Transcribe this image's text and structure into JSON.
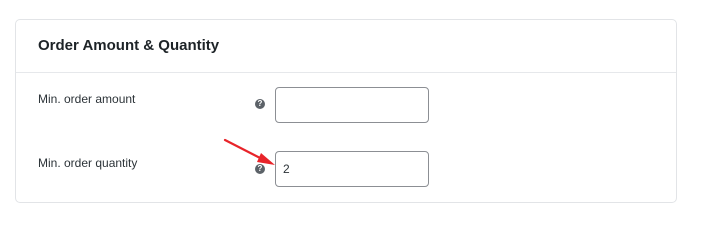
{
  "panel": {
    "title": "Order Amount & Quantity"
  },
  "rows": [
    {
      "label": "Min. order amount",
      "value": "",
      "help_icon": "question-mark-icon"
    },
    {
      "label": "Min. order quantity",
      "value": "2",
      "help_icon": "question-mark-icon"
    }
  ],
  "annotation": {
    "icon": "arrow-icon",
    "color": "#e8242a"
  },
  "colors": {
    "border": "#e2e4e7",
    "input_border": "#8c8f94",
    "title_text": "#1d2327",
    "help_icon_bg": "#5c6268"
  }
}
